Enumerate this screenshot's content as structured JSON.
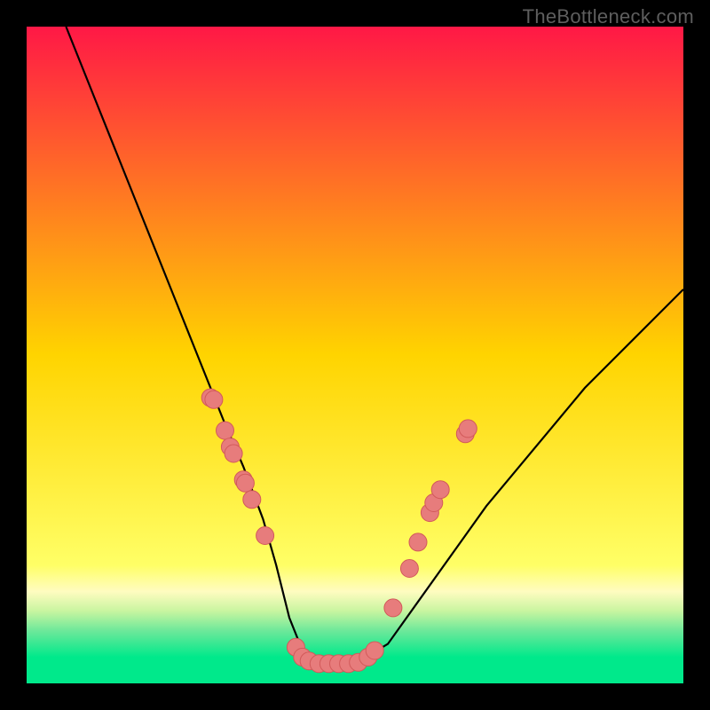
{
  "watermark": "TheBottleneck.com",
  "chart_data": {
    "type": "line",
    "title": "",
    "xlabel": "",
    "ylabel": "",
    "xlim": [
      0,
      100
    ],
    "ylim": [
      0,
      100
    ],
    "grid": false,
    "legend": "none",
    "background_gradient": {
      "stops": [
        {
          "offset": 0.0,
          "color": "#ff1846"
        },
        {
          "offset": 0.5,
          "color": "#ffd400"
        },
        {
          "offset": 0.82,
          "color": "#ffff66"
        },
        {
          "offset": 0.86,
          "color": "#fffcc0"
        },
        {
          "offset": 0.89,
          "color": "#c8f5a0"
        },
        {
          "offset": 0.92,
          "color": "#6de89a"
        },
        {
          "offset": 0.96,
          "color": "#00e98b"
        },
        {
          "offset": 1.0,
          "color": "#00e98b"
        }
      ]
    },
    "series": [
      {
        "name": "bottleneck-curve",
        "x": [
          6,
          10,
          14,
          18,
          22,
          26,
          28,
          30,
          33,
          36,
          38,
          40,
          42,
          44,
          46,
          50,
          55,
          60,
          65,
          70,
          75,
          80,
          85,
          90,
          95,
          100
        ],
        "y": [
          100,
          90,
          80,
          70,
          60,
          50,
          45,
          40,
          33,
          25,
          18,
          10,
          5,
          3,
          3,
          3,
          6,
          13,
          20,
          27,
          33,
          39,
          45,
          50,
          55,
          60
        ]
      }
    ],
    "marker_clusters": [
      {
        "name": "left-cluster",
        "points": [
          {
            "x": 28.0,
            "y": 43.5
          },
          {
            "x": 28.5,
            "y": 43.2
          },
          {
            "x": 30.2,
            "y": 38.5
          },
          {
            "x": 31.0,
            "y": 36.0
          },
          {
            "x": 31.5,
            "y": 35.0
          },
          {
            "x": 33.0,
            "y": 31.0
          },
          {
            "x": 33.3,
            "y": 30.5
          },
          {
            "x": 34.3,
            "y": 28.0
          },
          {
            "x": 36.3,
            "y": 22.5
          }
        ]
      },
      {
        "name": "bottom-cluster",
        "points": [
          {
            "x": 41.0,
            "y": 5.5
          },
          {
            "x": 42.0,
            "y": 4.0
          },
          {
            "x": 43.0,
            "y": 3.4
          },
          {
            "x": 44.5,
            "y": 3.0
          },
          {
            "x": 46.0,
            "y": 3.0
          },
          {
            "x": 47.5,
            "y": 3.0
          },
          {
            "x": 49.0,
            "y": 3.0
          },
          {
            "x": 50.5,
            "y": 3.2
          },
          {
            "x": 52.0,
            "y": 4.0
          },
          {
            "x": 53.0,
            "y": 5.0
          }
        ]
      },
      {
        "name": "right-cluster",
        "points": [
          {
            "x": 55.8,
            "y": 11.5
          },
          {
            "x": 58.3,
            "y": 17.5
          },
          {
            "x": 59.6,
            "y": 21.5
          },
          {
            "x": 61.4,
            "y": 26.0
          },
          {
            "x": 62.0,
            "y": 27.5
          },
          {
            "x": 63.0,
            "y": 29.5
          },
          {
            "x": 66.8,
            "y": 38.0
          },
          {
            "x": 67.2,
            "y": 38.8
          }
        ]
      }
    ],
    "marker_style": {
      "radius_px": 10,
      "fill": "#e77c7c",
      "stroke": "#d25a5a",
      "stroke_width": 1
    }
  }
}
